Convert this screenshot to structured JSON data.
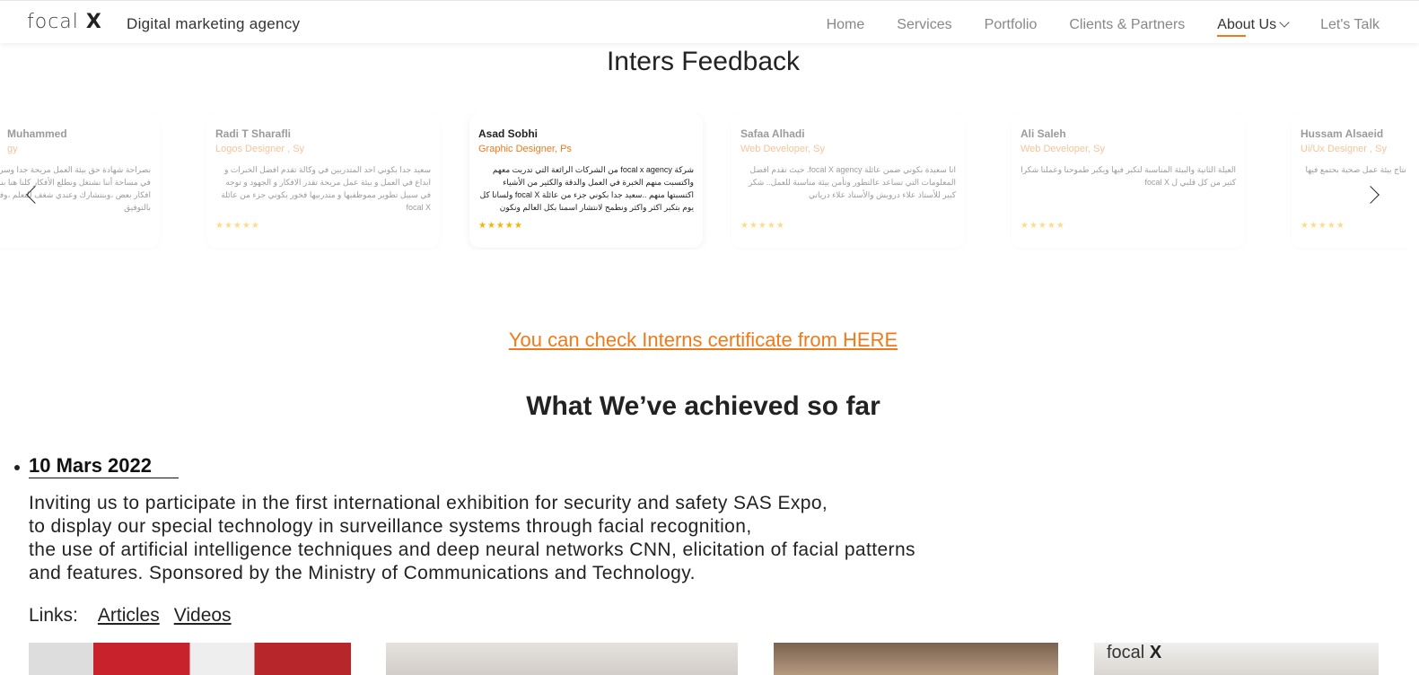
{
  "header": {
    "logo_text": "focal",
    "logo_mark": "X",
    "tagline": "Digital marketing agency",
    "nav": [
      {
        "label": "Home"
      },
      {
        "label": "Services"
      },
      {
        "label": "Portfolio"
      },
      {
        "label": "Clients & Partners"
      },
      {
        "label": "About Us"
      },
      {
        "label": "Let's Talk"
      }
    ]
  },
  "feedback": {
    "title": "Inters Feedback",
    "cards": [
      {
        "name": "Muhammed",
        "role": "gy",
        "text": "بصراحة شهادة حق بيئة العمل مريحة جدا وسريعة بالتدريب هنا في مساحة أننا نشتغل ونطلع الأفكار كلنا هنا بنساعد بعض وبنكمل افكار بعض ،وبنتشارك وعندي شغف للتعلم ،وفيه تشجيع منكم ، بالتوفيق",
        "stars": "★★★★★"
      },
      {
        "name": "Radi T Sharafli",
        "role": "Logos Designer , Sy",
        "text": "سعيد جدا بكوني احد المتدربين في وكالة تقدم افضل الخبرات و ابداع في العمل و بيئة عمل مريحة تقدر الافكار و الجهود و توجه في سبيل تطوير مموظفيها و متدربيها فخور بكوني جزء من عائلة focal X",
        "stars": "★★★★★"
      },
      {
        "name": "Asad Sobhi",
        "role": "Graphic Designer, Ps",
        "text": "شركة focal x agency من الشركات الرائعة التي تدربت معهم واكتسبت منهم الخبرة في العمل والدقة والكثير من الأشياء اكتسبتها منهم ..سعيد جدا بكوني جزء من عائلة focal X ولسانا كل يوم بتكبر اكثر واكثر ونطمح لانتشار اسمنا بكل العالم ونكون شركة عالمية ..",
        "stars": "★★★★★"
      },
      {
        "name": "Safaa Alhadi",
        "role": "Web Developer, Sy",
        "text": "انا سعيدة بكوني ضمن عائلة focal X agency. حيث تقدم افضل المعلومات التي تساعد عالتطور وتأمن بيئة مناسبة للعمل.. شكر كبير للأستاذ علاء درويش والأستاذ علاء درياتي",
        "stars": "★★★★★"
      },
      {
        "name": "Ali Saleh",
        "role": "Web Developer, Sy",
        "text": "العيلة الثانية والبيئة المناسبة لتكبر فيها ويكبر طموحنا وعملنا شكرا كتير من كل قلبي ل focal X",
        "stars": "★★★★★"
      },
      {
        "name": "Hussam Alsaeid",
        "role": "Ui/Ux Designer , Sy",
        "text": "المهارة والتعود على ضغط العمل نتاج بيئة عمل صحية بحتمع فيها خبرته خلال فترة تدريبي",
        "stars": "★★★★★"
      }
    ]
  },
  "certificate_link": "You can check Interns certificate from HERE",
  "achievements": {
    "title": "What We’ve achieved so far",
    "items": [
      {
        "date": "10 Mars 2022",
        "lines": [
          "Inviting us to participate in the first international exhibition for security and safety SAS Expo,",
          "to display our special technology in surveillance systems through facial recognition,",
          "the use of artificial intelligence techniques and deep neural networks CNN, elicitation of facial patterns",
          "and features. Sponsored by the Ministry of Communications and Technology."
        ],
        "links_label": "Links:",
        "links": [
          "Articles",
          "Videos"
        ]
      }
    ]
  },
  "colors": {
    "accent": "#f07a1a",
    "stars": "#f5b400"
  }
}
